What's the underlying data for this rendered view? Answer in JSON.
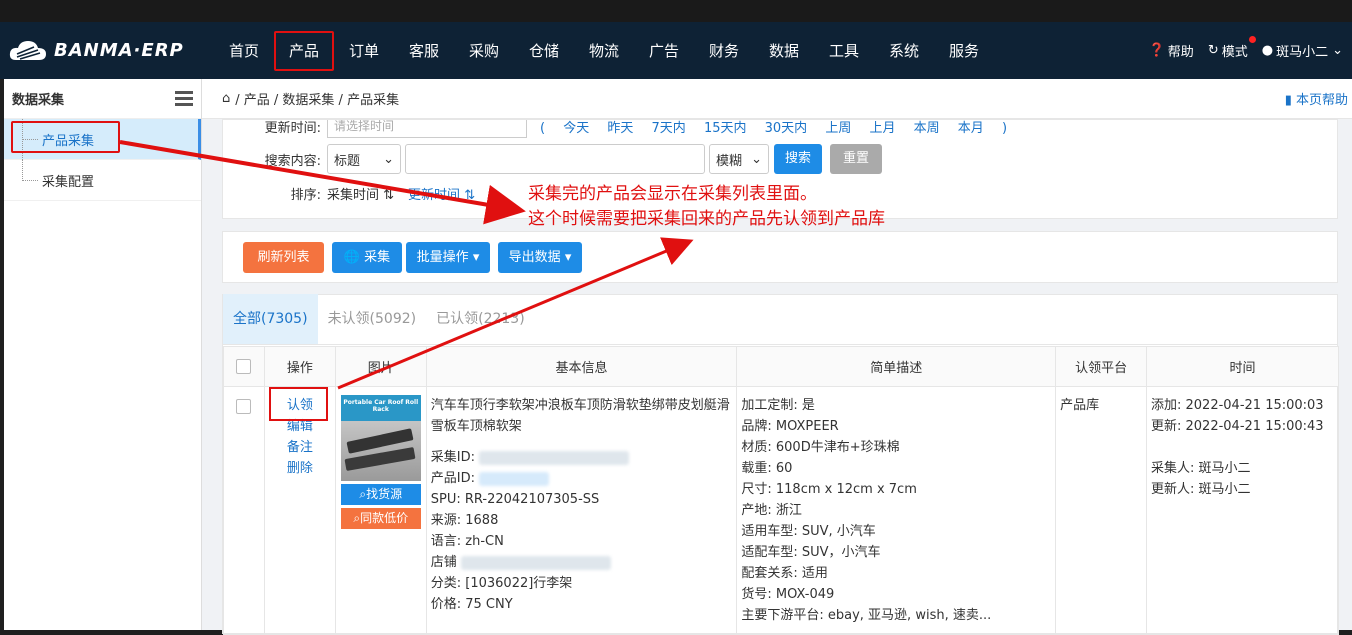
{
  "nav": {
    "logo_text": "BANMA·ERP",
    "items": [
      "首页",
      "产品",
      "订单",
      "客服",
      "采购",
      "仓储",
      "物流",
      "广告",
      "财务",
      "数据",
      "工具",
      "系统",
      "服务"
    ],
    "help": "帮助",
    "mode": "模式",
    "user": "斑马小二"
  },
  "sidebar": {
    "title": "数据采集",
    "items": [
      "产品采集",
      "采集配置"
    ]
  },
  "breadcrumb": {
    "path": "/ 产品 / 数据采集 / 产品采集",
    "help": "本页帮助"
  },
  "search": {
    "update_time_label": "更新时间:",
    "time_placeholder": "请选择时间",
    "quick_ranges": [
      "(",
      "今天",
      "昨天",
      "7天内",
      "15天内",
      "30天内",
      "上周",
      "上月",
      "本周",
      "本月",
      ")"
    ],
    "content_label": "搜索内容:",
    "field_select": "标题",
    "match_select": "模糊",
    "search_btn": "搜索",
    "reset_btn": "重置",
    "sort_label": "排序:",
    "sort_a": "采集时间",
    "sort_b": "更新时间"
  },
  "toolbar": {
    "refresh": "刷新列表",
    "collect": "采集",
    "batch": "批量操作",
    "export": "导出数据"
  },
  "tabs": [
    "全部(7305)",
    "未认领(5092)",
    "已认领(2213)"
  ],
  "table": {
    "headers": [
      "操作",
      "图片",
      "基本信息",
      "简单描述",
      "认领平台",
      "时间"
    ],
    "row": {
      "ops": [
        "认领",
        "编辑",
        "备注",
        "删除"
      ],
      "img_title": "Portable Car Roof Roll Rack",
      "img_btn1": "找货源",
      "img_btn2": "同款低价",
      "title": "汽车车顶行李软架冲浪板车顶防滑软垫绑带皮划艇滑雪板车顶棉软架",
      "collect_id": "采集ID:",
      "product_id": "产品ID:",
      "spu": "SPU:  RR-22042107305-SS",
      "source": "来源:  1688",
      "lang": "语言:  zh-CN",
      "shop": "店铺",
      "category": "分类:  [1036022]行李架",
      "price": "价格:  75 CNY",
      "desc": [
        "加工定制: 是",
        "品牌: MOXPEER",
        "材质: 600D牛津布+珍珠棉",
        "载重: 60",
        "尺寸: 118cm x 12cm x 7cm",
        "产地: 浙江",
        "适用车型: SUV, 小汽车",
        "适配车型: SUV，小汽车",
        "配套关系: 适用",
        "货号: MOX-049",
        "主要下游平台: ebay, 亚马逊, wish, 速卖..."
      ],
      "platform": "产品库",
      "added": "添加:  2022-04-21 15:00:03",
      "updated": "更新:  2022-04-21 15:00:43",
      "collector": "采集人:   斑马小二",
      "updater": "更新人:   斑马小二"
    }
  },
  "annotation": {
    "line1": "采集完的产品会显示在采集列表里面。",
    "line2": "这个时候需要把采集回来的产品先认领到产品库"
  },
  "colors": {
    "nav_bg": "#0e2235",
    "accent": "#1e8ce6",
    "orange": "#f4733f",
    "annotation_red": "#e01010"
  }
}
